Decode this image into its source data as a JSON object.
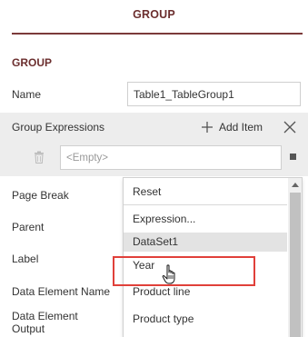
{
  "header": {
    "title": "GROUP"
  },
  "section": {
    "title": "GROUP"
  },
  "fields": {
    "name_label": "Name",
    "name_value": "Table1_TableGroup1",
    "page_break_label": "Page Break",
    "parent_label": "Parent",
    "label_label": "Label",
    "data_element_name_label": "Data Element Name",
    "data_element_output_label": "Data Element Output"
  },
  "group_expressions": {
    "label": "Group Expressions",
    "add_item_label": "Add Item",
    "expression_placeholder": "<Empty>"
  },
  "dropdown": {
    "items": [
      "Reset",
      "Expression...",
      "DataSet1",
      "Year",
      "Product line",
      "Product type"
    ],
    "selected": "DataSet1"
  },
  "colors": {
    "accent": "#6b2e2e",
    "highlight": "#e0403a"
  },
  "icons": [
    "plus-icon",
    "close-icon",
    "trash-icon",
    "square-icon",
    "hand-cursor-icon"
  ]
}
